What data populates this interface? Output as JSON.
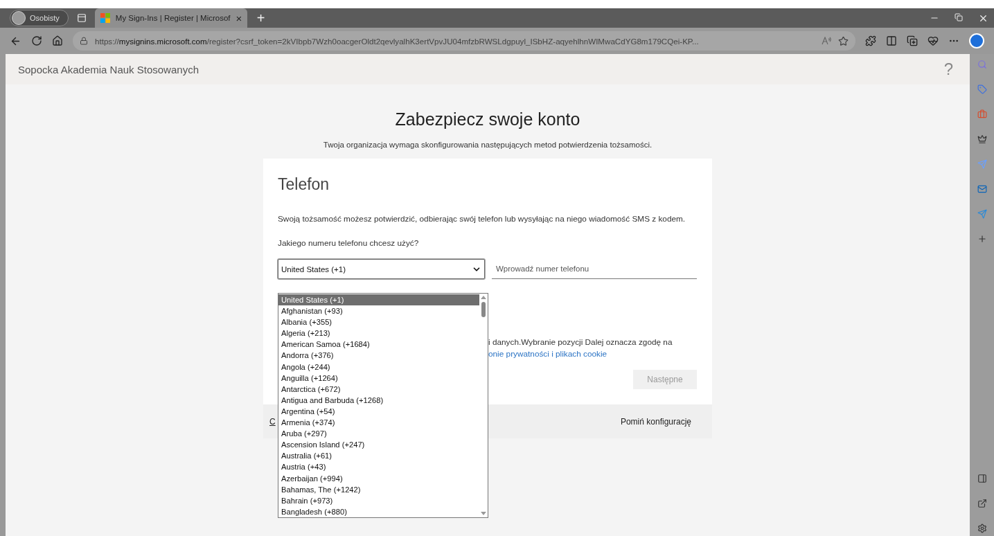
{
  "browser": {
    "profile": "Osobisty",
    "tab": {
      "title": "My Sign-Ins | Register | Microsof",
      "close": "×"
    },
    "new_tab": "+",
    "url": "https://**mysignins.microsoft.com**/register?csrf_token=2kVIbpb7Wzh0oacgerOldt2qevlyalhK3ertVpvJU04mfzbRWSLdgpuyl_ISbHZ-aqyehlhnWIMwaCdYG8m179CQei-KP..."
  },
  "header": {
    "organization": "Sopocka Akademia Nauk Stosowanych",
    "help": "?"
  },
  "page": {
    "title": "Zabezpiecz swoje konto",
    "subtitle": "Twoja organizacja wymaga skonfigurowania następujących metod potwierdzenia tożsamości."
  },
  "card": {
    "heading": "Telefon",
    "description": "Swoją tożsamość możesz potwierdzić, odbierając swój telefon lub wysyłając na niego wiadomość SMS z kodem.",
    "question": "Jakiego numeru telefonu chcesz użyć?",
    "country_select": {
      "value": "United States (+1)",
      "expanded": true
    },
    "phone_field": {
      "placeholder": "Wprowadź numer telefonu"
    },
    "consent_text": "i danych.Wybranie pozycji Dalej oznacza zgodę na",
    "consent_link": "onie prywatności i plikach cookie",
    "next_button": {
      "label": "Następne",
      "disabled": true
    },
    "footer": {
      "left_link": "C",
      "skip_link": "Pomiń konfigurację"
    }
  },
  "country_options": [
    {
      "label": "United States (+1)",
      "selected": true
    },
    {
      "label": "Afghanistan (+93)",
      "selected": false
    },
    {
      "label": "Albania (+355)",
      "selected": false
    },
    {
      "label": "Algeria (+213)",
      "selected": false
    },
    {
      "label": "American Samoa (+1684)",
      "selected": false
    },
    {
      "label": "Andorra (+376)",
      "selected": false
    },
    {
      "label": "Angola (+244)",
      "selected": false
    },
    {
      "label": "Anguilla (+1264)",
      "selected": false
    },
    {
      "label": "Antarctica (+672)",
      "selected": false
    },
    {
      "label": "Antigua and Barbuda (+1268)",
      "selected": false
    },
    {
      "label": "Argentina (+54)",
      "selected": false
    },
    {
      "label": "Armenia (+374)",
      "selected": false
    },
    {
      "label": "Aruba (+297)",
      "selected": false
    },
    {
      "label": "Ascension Island (+247)",
      "selected": false
    },
    {
      "label": "Australia (+61)",
      "selected": false
    },
    {
      "label": "Austria (+43)",
      "selected": false
    },
    {
      "label": "Azerbaijan (+994)",
      "selected": false
    },
    {
      "label": "Bahamas, The (+1242)",
      "selected": false
    },
    {
      "label": "Bahrain (+973)",
      "selected": false
    },
    {
      "label": "Bangladesh (+880)",
      "selected": false
    }
  ]
}
